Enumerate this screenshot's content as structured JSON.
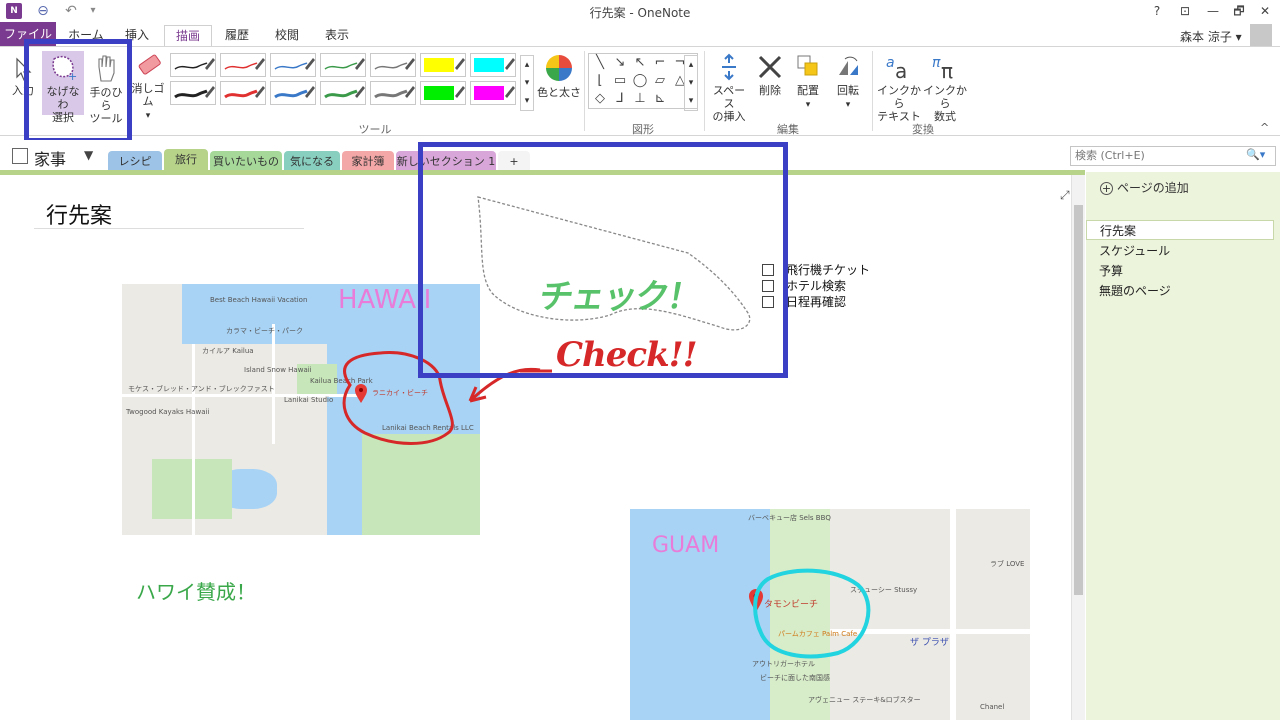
{
  "window": {
    "title": "行先案 - OneNote",
    "controls": [
      "?",
      "⊡",
      "—",
      "🗗",
      "✕"
    ]
  },
  "ribbon_tabs": [
    "ファイル",
    "ホーム",
    "挿入",
    "描画",
    "履歴",
    "校閲",
    "表示"
  ],
  "user": {
    "name": "森本 涼子 ▾"
  },
  "ribbon": {
    "tools": {
      "input_label": "入力",
      "lasso_label_1": "なげなわ",
      "lasso_label_2": "選択",
      "hand_label_1": "手のひら",
      "hand_label_2": "ツール",
      "eraser_label": "消しゴム",
      "group_label": "ツール"
    },
    "pens": [
      {
        "color": "#222222",
        "thick": 1.5
      },
      {
        "color": "#e03030",
        "thick": 1.5
      },
      {
        "color": "#3a78c8",
        "thick": 1.5
      },
      {
        "color": "#3a9a4a",
        "thick": 1.5
      },
      {
        "color": "#777777",
        "thick": 1.5
      },
      {
        "color": "#ffff00",
        "fill": true
      },
      {
        "color": "#00ffff",
        "fill": true
      },
      {
        "color": "#222222",
        "thick": 3
      },
      {
        "color": "#e03030",
        "thick": 3
      },
      {
        "color": "#3a78c8",
        "thick": 3
      },
      {
        "color": "#3a9a4a",
        "thick": 3
      },
      {
        "color": "#777777",
        "thick": 3
      },
      {
        "color": "#00ee00",
        "fill": true
      },
      {
        "color": "#ff00ff",
        "fill": true
      }
    ],
    "color_thickness_label": "色と太さ",
    "shapes_group_label": "図形",
    "edit": {
      "insert_space_1": "スペース",
      "insert_space_2": "の挿入",
      "delete": "削除",
      "arrange": "配置",
      "rotate": "回転",
      "group_label": "編集"
    },
    "convert": {
      "ink_to_text_1": "インクから",
      "ink_to_text_2": "テキスト",
      "ink_to_math_1": "インクから",
      "ink_to_math_2": "数式",
      "group_label": "変換"
    }
  },
  "notebook": {
    "name": "家事",
    "dropdown": "▼"
  },
  "sections": [
    {
      "label": "レシピ",
      "color": "#9dc3e6"
    },
    {
      "label": "旅行",
      "color": "#b7d38a"
    },
    {
      "label": "買いたいもの",
      "color": "#a6d89a"
    },
    {
      "label": "気になる",
      "color": "#88cfc0"
    },
    {
      "label": "家計簿",
      "color": "#f4a7a7"
    },
    {
      "label": "新しいセクション 1",
      "color": "#d8a6d8"
    },
    {
      "label": "+",
      "color": "#f4f4f4"
    }
  ],
  "search": {
    "placeholder": "検索 (Ctrl+E)",
    "icon": "🔍▾"
  },
  "page": {
    "title": "行先案",
    "hawaii_label": "HAWAII",
    "guam_label": "GUAM",
    "hawaii_agree": "ハワイ賛成！",
    "check_ink": "チェック！",
    "check_ink_en": "Check!!",
    "checklist": [
      "飛行機チケット",
      "ホテル検索",
      "日程再確認"
    ],
    "hawaii_map_labels": [
      "Best Beach Hawaii Vacation",
      "カラマ・ビーチ・パーク",
      "カイルア Kailua",
      "Island Snow Hawaii",
      "Kailua Beach Park",
      "モケス・ブレッド・アンド・ブレックファスト",
      "Twogood Kayaks Hawaii",
      "Lanikai Studio",
      "ラニカイ・ビーチ",
      "Lanikai Beach Rentals LLC"
    ],
    "guam_map_labels": [
      "バーベキュー店 Sels BBQ",
      "タモンビーチ",
      "ステューシー Stussy",
      "パームカフェ Palm Cafe",
      "ザ プラザ",
      "アウトリガーホテル",
      "ビーチに面した南国感",
      "アヴェニュー ステーキ&ロブスター",
      "Chanel",
      "ラブ LOVE"
    ]
  },
  "pagelist": {
    "add_label": "ページの追加",
    "items": [
      "行先案",
      "スケジュール",
      "予算",
      "無題のページ"
    ]
  },
  "colors": {
    "accent": "#7a3a8f",
    "highlight": "#3b3fc4",
    "section_green": "#b7d38a"
  }
}
